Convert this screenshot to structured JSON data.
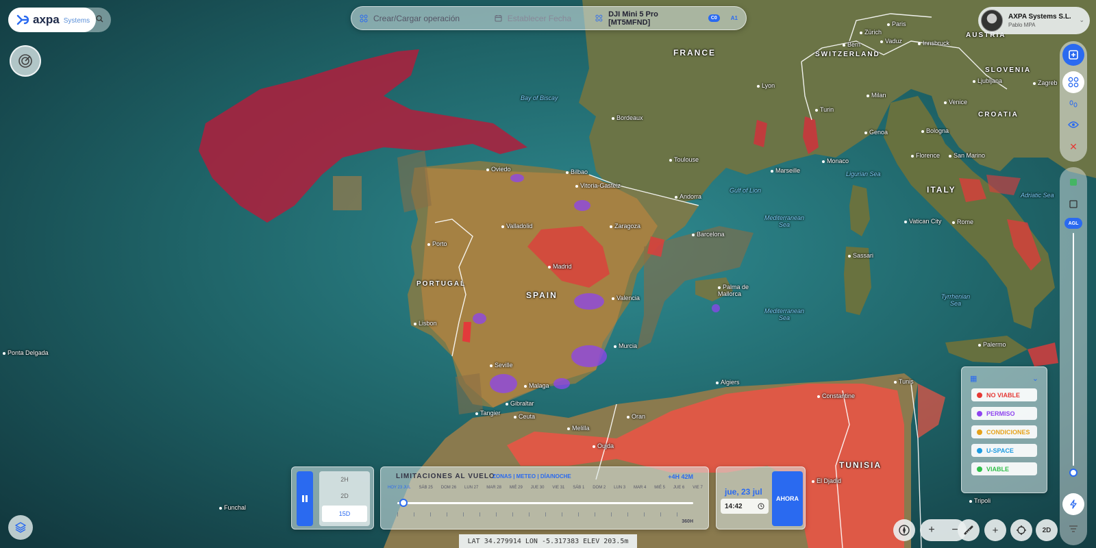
{
  "logo": {
    "brand": "axpa",
    "sub": "Systems"
  },
  "topbar": {
    "create_operation": "Crear/Cargar operación",
    "set_date": "Establecer Fecha",
    "drone": "DJI Mini 5 Pro [MT5MFND]",
    "class_badge": "C0",
    "category_badge": "A1"
  },
  "user": {
    "company": "AXPA Systems S.L.",
    "name": "Pablo MPA"
  },
  "map_labels": {
    "countries": [
      "FRANCE",
      "SWITZERLAND",
      "AUSTRIA",
      "SLOVENIA",
      "CROATIA",
      "ITALY",
      "PORTUGAL",
      "SPAIN",
      "TUNISIA"
    ],
    "seas": [
      "Bay of Biscay",
      "Gulf of Lion",
      "Ligurian Sea",
      "Mediterranean Sea",
      "Mediterranean Sea",
      "Tyrrhenian Sea",
      "Adriatic Sea"
    ],
    "cities": [
      "Paris",
      "Bern",
      "Zürich",
      "Vaduz",
      "Innsbruck",
      "Ljubljana",
      "Zagreb",
      "Lyon",
      "Milan",
      "Turin",
      "Genoa",
      "Bologna",
      "Venice",
      "Florence",
      "San Marino",
      "Monaco",
      "Bordeaux",
      "Toulouse",
      "Marseille",
      "Andorra",
      "Barcelona",
      "Oviedo",
      "Bilbao",
      "Vitoria-Gasteiz",
      "Zaragoza",
      "Valladolid",
      "Porto",
      "Madrid",
      "Valencia",
      "Palma de Mallorca",
      "Lisbon",
      "Murcia",
      "Seville",
      "Malaga",
      "Gibraltar",
      "Tangier",
      "Ceuta",
      "Melilla",
      "Oran",
      "Oujda",
      "Algiers",
      "Constantine",
      "Tunis",
      "Palermo",
      "Vatican City",
      "Rome",
      "Sassari",
      "El Djadid",
      "Tripoli",
      "Ponta Delgada",
      "Funchal"
    ]
  },
  "legend": {
    "items": [
      {
        "label": "NO VIABLE",
        "color": "#e53935"
      },
      {
        "label": "PERMISO",
        "color": "#8e44ef"
      },
      {
        "label": "CONDICIONES",
        "color": "#e6a21a"
      },
      {
        "label": "U-SPACE",
        "color": "#1e9be0"
      },
      {
        "label": "VIABLE",
        "color": "#2fbf4a"
      }
    ]
  },
  "range": {
    "options": [
      "2H",
      "2D",
      "15D"
    ],
    "selected": "15D"
  },
  "timeline": {
    "title": "LIMITACIONES AL VUELO",
    "tabs": "ZONAS | METEO | DÍA/NOCHE",
    "duration": "+4H 42M",
    "days": [
      "HOY 23 JUL",
      "SÁB 25",
      "DOM 26",
      "LUN 27",
      "MAR 28",
      "MIÉ 29",
      "JUE 30",
      "VIE 31",
      "SÁB 1",
      "DOM 2",
      "LUN 3",
      "MAR 4",
      "MIÉ 5",
      "JUE 6",
      "VIE 7"
    ],
    "end_label": "360H",
    "position": 0.02
  },
  "datetime": {
    "date": "jue, 23 jul",
    "time": "14:42",
    "now_button": "AHORA"
  },
  "coords": {
    "lat_label": "LAT",
    "lat": "34.279914",
    "lon_label": "LON",
    "lon": "-5.317383",
    "elev_label": "ELEV",
    "elev": "203.5m"
  },
  "controls": {
    "agl": "AGL",
    "view_mode": "2D"
  },
  "colors": {
    "accent": "#2a6af0",
    "no_viable": "#e53935",
    "ocean": "#1d5a60"
  }
}
